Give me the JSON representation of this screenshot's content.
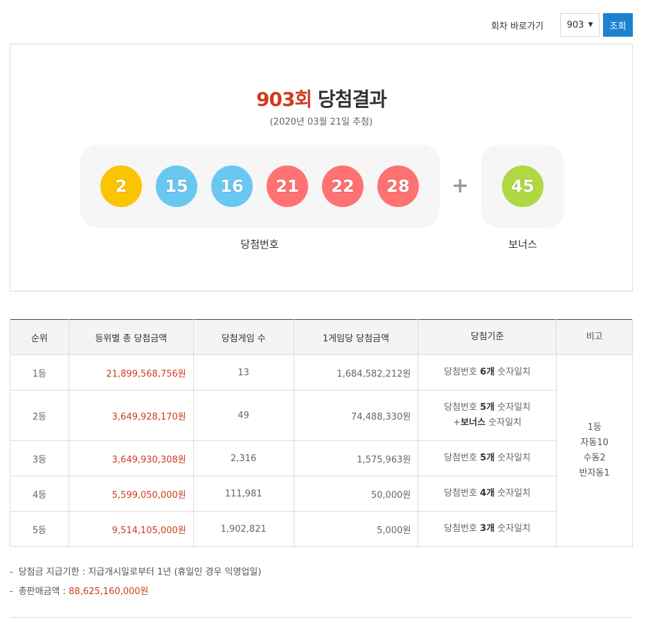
{
  "round_bar": {
    "label": "회차 바로가기",
    "selected_round": "903",
    "caret": "▼",
    "search_label": "조회"
  },
  "result": {
    "round": "903회",
    "title_suffix": " 당첨결과",
    "date": "(2020년 03월 21일 추첨)",
    "winning_numbers": [
      "2",
      "15",
      "16",
      "21",
      "22",
      "28"
    ],
    "plus": "+",
    "bonus_number": "45",
    "winning_label": "당첨번호",
    "bonus_label": "보너스",
    "ball_colors": {
      "yellow": "#fbc400",
      "blue": "#69c8f2",
      "red": "#ff7272",
      "green": "#b0d840"
    }
  },
  "table": {
    "headers": [
      "순위",
      "등위별 총 당첨금액",
      "당첨게임 수",
      "1게임당 당첨금액",
      "당첨기준",
      "비고"
    ],
    "rows": [
      {
        "rank": "1등",
        "total": "21,899,568,756원",
        "count": "13",
        "per_game": "1,684,582,212원",
        "crit_pre": "당첨번호 ",
        "crit_bold": "6개",
        "crit_post": " 숫자일치"
      },
      {
        "rank": "2등",
        "total": "3,649,928,170원",
        "count": "49",
        "per_game": "74,488,330원",
        "crit_pre": "당첨번호 ",
        "crit_bold": "5개",
        "crit_post": " 숫자일치",
        "crit2_pre": "+",
        "crit2_bold": "보너스",
        "crit2_post": " 숫자일치"
      },
      {
        "rank": "3등",
        "total": "3,649,930,308원",
        "count": "2,316",
        "per_game": "1,575,963원",
        "crit_pre": "당첨번호 ",
        "crit_bold": "5개",
        "crit_post": " 숫자일치"
      },
      {
        "rank": "4등",
        "total": "5,599,050,000원",
        "count": "111,981",
        "per_game": "50,000원",
        "crit_pre": "당첨번호 ",
        "crit_bold": "4개",
        "crit_post": " 숫자일치"
      },
      {
        "rank": "5등",
        "total": "9,514,105,000원",
        "count": "1,902,821",
        "per_game": "5,000원",
        "crit_pre": "당첨번호 ",
        "crit_bold": "3개",
        "crit_post": " 숫자일치"
      }
    ],
    "note_lines": [
      "1등",
      "자동10",
      "수동2",
      "반자동1"
    ]
  },
  "notes": {
    "dash": "-",
    "payment_deadline": "당첨금 지급기한 : 지급개시일로부터 1년 (휴일인 경우 익영업일)",
    "total_sales_label": "총판매금액 : ",
    "total_sales_value": "88,625,160,000원"
  }
}
